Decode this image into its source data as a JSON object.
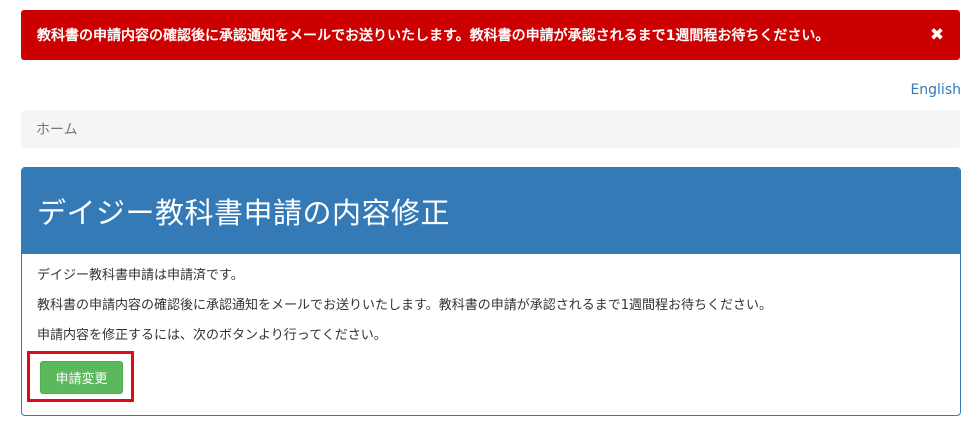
{
  "alert": {
    "message": "教科書の申請内容の確認後に承認通知をメールでお送りいたします。教科書の申請が承認されるまで1週間程お待ちください。",
    "close_glyph": "✖",
    "background_color": "#cc0000"
  },
  "language": {
    "link_label": "English"
  },
  "breadcrumb": {
    "home": "ホーム"
  },
  "panel": {
    "title": "デイジー教科書申請の内容修正",
    "header_color": "#337ab7",
    "lines": [
      "デイジー教科書申請は申請済です。",
      "教科書の申請内容の確認後に承認通知をメールでお送りいたします。教科書の申請が承認されるまで1週間程お待ちください。",
      "申請内容を修正するには、次のボタンより行ってください。"
    ],
    "change_button_label": "申請変更",
    "button_color": "#5cb85c",
    "highlight_color": "#e3071b"
  }
}
